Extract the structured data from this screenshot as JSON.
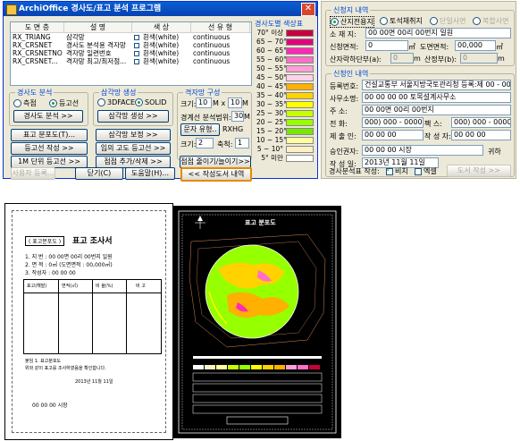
{
  "window": {
    "title": "ArchiOffice 경사도/표고 분석 프로그램",
    "close_glyph": "✕"
  },
  "layer_table": {
    "headers": [
      "도 면 층",
      "설  명",
      "색 상",
      "선 유 형"
    ],
    "rows": [
      {
        "layer": "RX_TRIANG",
        "desc": "삼각망",
        "color": "흰색(white)",
        "linetype": "continuous"
      },
      {
        "layer": "RX_CRSNET",
        "desc": "경사도 분석용 격자망",
        "color": "흰색(white)",
        "linetype": "continuous"
      },
      {
        "layer": "RX_CRSNETNO",
        "desc": "격자망 일련번호",
        "color": "흰색(white)",
        "linetype": "continuous"
      },
      {
        "layer": "RX_CRSNET...",
        "desc": "격자망 최고/최저점...",
        "color": "흰색(white)",
        "linetype": "continuous"
      }
    ]
  },
  "legend": {
    "title": "경사도별 색상표",
    "items": [
      {
        "label": "70° 이상",
        "color": "#c8003c"
      },
      {
        "label": "65 ~ 70°",
        "color": "#e4007c"
      },
      {
        "label": "60 ~ 65°",
        "color": "#ff2ab4"
      },
      {
        "label": "55 ~ 60°",
        "color": "#ff6ec8"
      },
      {
        "label": "50 ~ 55°",
        "color": "#ff9ed8"
      },
      {
        "label": "45 ~ 50°",
        "color": "#ffd2ea"
      },
      {
        "label": "40 ~ 45°",
        "color": "#ffb000"
      },
      {
        "label": "35 ~ 40°",
        "color": "#ffd200"
      },
      {
        "label": "30 ~ 35°",
        "color": "#ffff00"
      },
      {
        "label": "25 ~ 30°",
        "color": "#c8ff00"
      },
      {
        "label": "20 ~ 25°",
        "color": "#96ff00"
      },
      {
        "label": "15 ~ 20°",
        "color": "#78e600"
      },
      {
        "label": "10 ~ 15°",
        "color": "#ffff9c"
      },
      {
        "label": "5 ~ 10°",
        "color": "#fff0c8"
      },
      {
        "label": "5° 미만",
        "color": "#ffffff"
      }
    ]
  },
  "slope_group": {
    "title": "경사도 분석",
    "radio_a": "측점",
    "radio_b": "등고선",
    "button": "경사도 분석 >>"
  },
  "triangle_group": {
    "title": "삼각망 생성",
    "radio_a": "3DFACE",
    "radio_b": "SOLID",
    "button": "삼각망 생성 >>"
  },
  "grid_group": {
    "title": "격자망 구성",
    "size_label": "크기:",
    "size_w": "10",
    "x_label": "M x",
    "size_h": "10",
    "m_label": "M",
    "contour_label": "경계선 분석범위:",
    "contour_value": "30",
    "contour_unit": "M",
    "text_button": "문자 유형..",
    "font_value": "RXHG",
    "size2_label": "크기:",
    "size2_value": "2",
    "scale_label": "축척:",
    "scale_value": "1"
  },
  "buttons": {
    "elev_map": "표고 분포도(T)...",
    "tri_correct": "삼각망 보정 >>",
    "contour_create": "등고선 작성 >>",
    "arbitrary_contour": "임의 고도 등고선 >>",
    "one_m_contour": "1M 단위 등고선 >>",
    "point_edit": "점점 추가/삭제 >>",
    "grid_shrink": "점점 줄이기/늘이기>>",
    "user_register": "사용자 등록...",
    "close": "닫기(C)",
    "help": "도움말(H)...",
    "report_writer": "<< 작성도서 내역"
  },
  "applicant": {
    "title": "신청지 내역",
    "type_a": "산지전용지",
    "type_b": "토석채취지",
    "type_c": "단일사면",
    "type_d": "복합사면",
    "addr_label": "소 재 지:",
    "addr_value": "00 00면 00리 00번지 일원",
    "area_label": "신청면적:",
    "area_value": "0",
    "area_unit": "㎡",
    "drawing_area_label": "도면면적:",
    "drawing_area_value": "00,000",
    "drawing_area_unit": "㎡",
    "mountain_label": "산자락하단부(a):",
    "mountain_value": "0",
    "mountain_unit": "m",
    "height_label": "산정부(b):",
    "height_value": "0",
    "height_unit": "m"
  },
  "requester": {
    "title": "신청인 내역",
    "reg_label": "등록번호:",
    "reg_value": "건설교통부 서울지방국토관리청 등록:제 00 - 00",
    "office_label": "사무소명:",
    "office_value": "00 00 00 00 토목설계사무소",
    "addr_label": "주    소:",
    "addr_value": "00 00면 00리 00번지",
    "tel_label": "전    화:",
    "tel_value": "000) 000 - 0000",
    "fax_label": "팩    스:",
    "fax_value": "000) 000 - 0000",
    "maker_label": "제 출 인:",
    "maker_value": "00 00 00",
    "writer_label": "작 성 자:",
    "writer_value": "00 00 00",
    "approver_label": "승인권자:",
    "approver_value": "00 00 00 시장",
    "approver_suffix": "귀하",
    "date_label": "작 성 일:",
    "date_value": "2013년 11월 11일",
    "output_label": "경사분석표 작성:",
    "output_a": "비치",
    "output_b": "엑셀",
    "output_button": "도서 작성 >>"
  },
  "sheet1": {
    "title": "표고 조사서",
    "header_line": "( 표고분포도 )",
    "line_a": "1. 지 번 : 00 00면 00리 00번지 일원",
    "line_b": "2. 면 적 : 0㎡ (도면면적 : 00,000㎡)",
    "line_c": "3. 작성자 : 00 00 00",
    "col_a": "표고(해발)",
    "col_b": "면적(㎡)",
    "col_c": "비 율(%)",
    "col_d": "비 고",
    "note_a": "붙임 1. 표고분포도",
    "note_b": "위와 같이 표고를 조사하였음을 확인합니다.",
    "date": "2013년 11월 11일",
    "signer": "00 00 00 시장"
  },
  "sheet2": {
    "title": "표고 분포도"
  }
}
